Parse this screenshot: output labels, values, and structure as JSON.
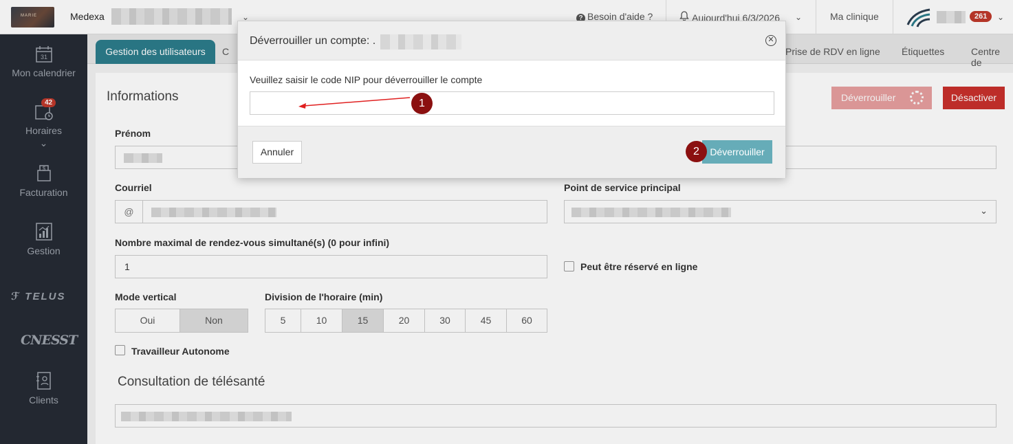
{
  "topbar": {
    "app_name": "Medexa",
    "help_label": "Besoin d'aide ?",
    "date_label": "Aujourd'hui 6/3/2026",
    "clinic_label": "Ma clinique",
    "notification_count": "261",
    "logo_text": "MARIE"
  },
  "sidebar": {
    "items": [
      {
        "label": "Mon calendrier",
        "icon": "calendar-icon",
        "icon_text": "31"
      },
      {
        "label": "Horaires",
        "icon": "schedule-clock-icon",
        "badge": "42"
      },
      {
        "label": "Facturation",
        "icon": "invoice-icon"
      },
      {
        "label": "Gestion",
        "icon": "chart-icon"
      },
      {
        "label": "Clients",
        "icon": "contacts-icon"
      }
    ],
    "partner_telus": "TELUS",
    "partner_cnesst": "CNESST"
  },
  "tabs": {
    "active": "Gestion des utilisateurs",
    "partial": "C",
    "others": [
      "Prise de RDV en ligne",
      "Étiquettes",
      "Centre de"
    ]
  },
  "form": {
    "section_title": "Informations",
    "unlock_button": "Déverrouiller",
    "disable_button": "Désactiver",
    "first_name_label": "Prénom",
    "email_label": "Courriel",
    "email_prefix": "@",
    "service_point_label": "Point de service principal",
    "max_appointments_label": "Nombre maximal de rendez-vous simultané(s) (0 pour infini)",
    "max_appointments_value": "1",
    "online_booking_label": "Peut être réservé en ligne",
    "vertical_mode_label": "Mode vertical",
    "vertical_mode_options": [
      "Oui",
      "Non"
    ],
    "vertical_mode_selected": "Non",
    "schedule_division_label": "Division de l'horaire (min)",
    "schedule_division_options": [
      "5",
      "10",
      "15",
      "20",
      "30",
      "45",
      "60"
    ],
    "schedule_division_selected": "15",
    "self_employed_label": "Travailleur Autonome",
    "telehealth_title": "Consultation de télésanté"
  },
  "modal": {
    "title": "Déverrouiller un compte: .",
    "prompt": "Veuillez saisir le code NIP pour déverrouiller le compte",
    "pin_value": "",
    "cancel_label": "Annuler",
    "confirm_label": "Déverrouiller",
    "close_symbol": "✕"
  },
  "annotations": {
    "marker_1": "1",
    "marker_2": "2",
    "color": "#8b1010",
    "arrow_color": "#e02020"
  },
  "colors": {
    "sidebar_bg": "#262b35",
    "active_tab": "#2c7d8c",
    "primary_button": "#66acb8",
    "danger_button": "#c9302c",
    "badge": "#c0392b"
  }
}
